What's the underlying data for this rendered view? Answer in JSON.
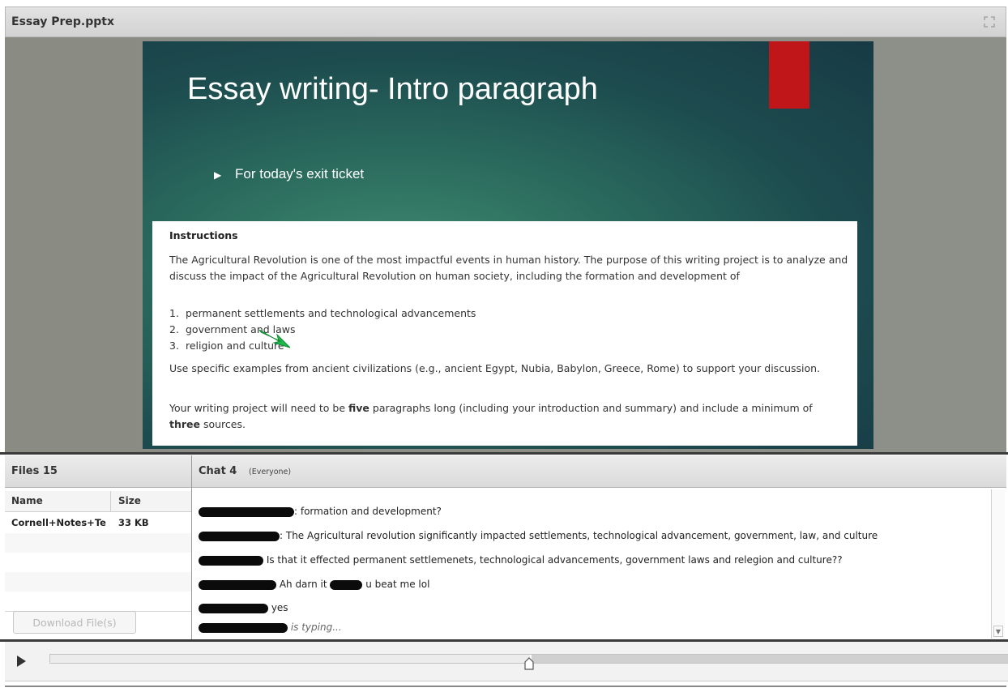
{
  "window": {
    "title": "Essay Prep.pptx",
    "expand_icon": "expand-icon"
  },
  "slide": {
    "title": "Essay writing- Intro paragraph",
    "bullet": "For today's exit ticket",
    "accent_color": "#c0161a",
    "instructions": {
      "heading": "Instructions",
      "intro": "The Agricultural Revolution is one of the most impactful events in human history. The purpose of this writing project is to analyze and discuss the impact of the Agricultural Revolution on human society, including the formation and development of",
      "items": [
        {
          "num": "1.",
          "text": "permanent settlements and technological advancements"
        },
        {
          "num": "2.",
          "text": "government and laws"
        },
        {
          "num": "3.",
          "text": "religion and culture"
        }
      ],
      "examples": "Use specific examples from ancient civilizations (e.g., ancient Egypt, Nubia, Babylon, Greece, Rome) to support your discussion.",
      "length_pre": "Your writing project will need to be ",
      "length_bold1": "five",
      "length_mid": " paragraphs long (including your introduction and summary) and include a minimum of ",
      "length_bold2": "three",
      "length_post": " sources."
    }
  },
  "files": {
    "title": "Files 15",
    "columns": {
      "name": "Name",
      "size": "Size"
    },
    "rows": [
      {
        "name": "Cornell+Notes+Te",
        "size": "33 KB"
      }
    ],
    "download_label": "Download File(s)"
  },
  "chat": {
    "title": "Chat 4",
    "audience": "(Everyone)",
    "messages": [
      {
        "text": ": formation and development?"
      },
      {
        "text": ": The Agricultural revolution significantly impacted settlements, technological advancement, government, law, and culture"
      },
      {
        "text": " Is that it effected permanent settlemenets, technological advancements, government laws and relegion and culture??"
      },
      {
        "text": " Ah darn it",
        "text2": " u beat me lol"
      },
      {
        "text": " yes"
      },
      {
        "text": " is typing..."
      }
    ]
  },
  "player": {
    "progress": 0.5
  }
}
